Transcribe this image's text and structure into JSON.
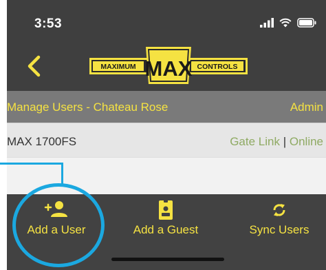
{
  "status_bar": {
    "time": "3:53"
  },
  "nav": {
    "back_icon": "chevron-left-icon",
    "logo": {
      "left": "MAXIMUM",
      "center": "MAX",
      "right": "CONTROLS"
    }
  },
  "header": {
    "title": "Manage Users - Chateau Rose",
    "role": "Admin"
  },
  "device": {
    "name": "MAX 1700FS",
    "gate_link": "Gate Link",
    "separator": "|",
    "status": "Online"
  },
  "tabs": [
    {
      "label": "Add a User",
      "icon": "add-user-icon"
    },
    {
      "label": "Add a Guest",
      "icon": "id-badge-icon"
    },
    {
      "label": "Sync Users",
      "icon": "sync-icon"
    }
  ],
  "colors": {
    "accent": "#f5e242",
    "online": "#8faa63",
    "callout": "#1ba8e0",
    "background": "#3f3f3f"
  }
}
